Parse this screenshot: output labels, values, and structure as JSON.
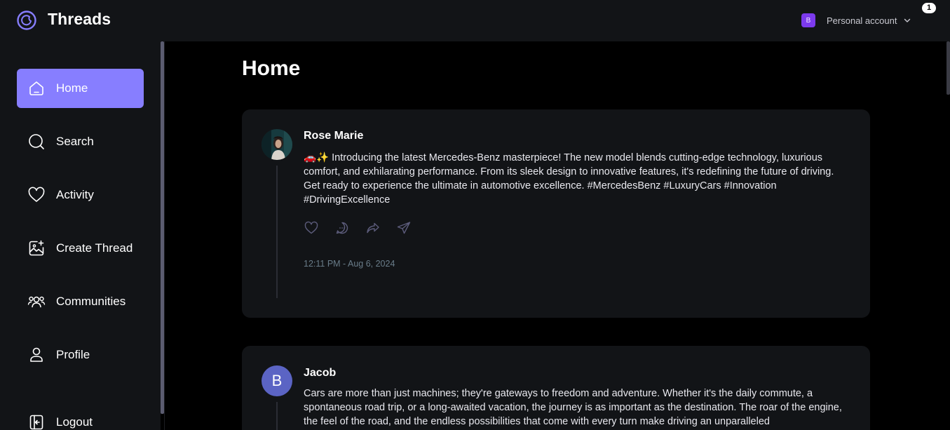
{
  "app": {
    "title": "Threads"
  },
  "account": {
    "avatar_letter": "B",
    "name": "Personal account",
    "notification_count": "1"
  },
  "sidebar": {
    "items": [
      {
        "label": "Home",
        "icon": "home-icon",
        "active": true
      },
      {
        "label": "Search",
        "icon": "search-icon",
        "active": false
      },
      {
        "label": "Activity",
        "icon": "heart-icon",
        "active": false
      },
      {
        "label": "Create Thread",
        "icon": "create-thread-icon",
        "active": false
      },
      {
        "label": "Communities",
        "icon": "communities-icon",
        "active": false
      },
      {
        "label": "Profile",
        "icon": "profile-icon",
        "active": false
      },
      {
        "label": "Logout",
        "icon": "logout-icon",
        "active": false
      }
    ]
  },
  "main": {
    "title": "Home",
    "threads": [
      {
        "author": "Rose Marie",
        "text": "🚗✨ Introducing the latest Mercedes-Benz masterpiece! The new model blends cutting-edge technology, luxurious comfort, and exhilarating performance. From its sleek design to innovative features, it's redefining the future of driving. Get ready to experience the ultimate in automotive excellence. #MercedesBenz #LuxuryCars #Innovation #DrivingExcellence",
        "timestamp": "12:11 PM - Aug 6, 2024"
      },
      {
        "author": "Jacob",
        "avatar_letter": "B",
        "text": "Cars are more than just machines; they're gateways to freedom and adventure. Whether it's the daily commute, a spontaneous road trip, or a long-awaited vacation, the journey is as important as the destination. The roar of the engine, the feel of the road, and the endless possibilities that come with every turn make driving an unparalleled"
      }
    ]
  },
  "colors": {
    "accent": "#877eff",
    "card": "#121417",
    "background": "#000000",
    "muted": "#697c89"
  }
}
